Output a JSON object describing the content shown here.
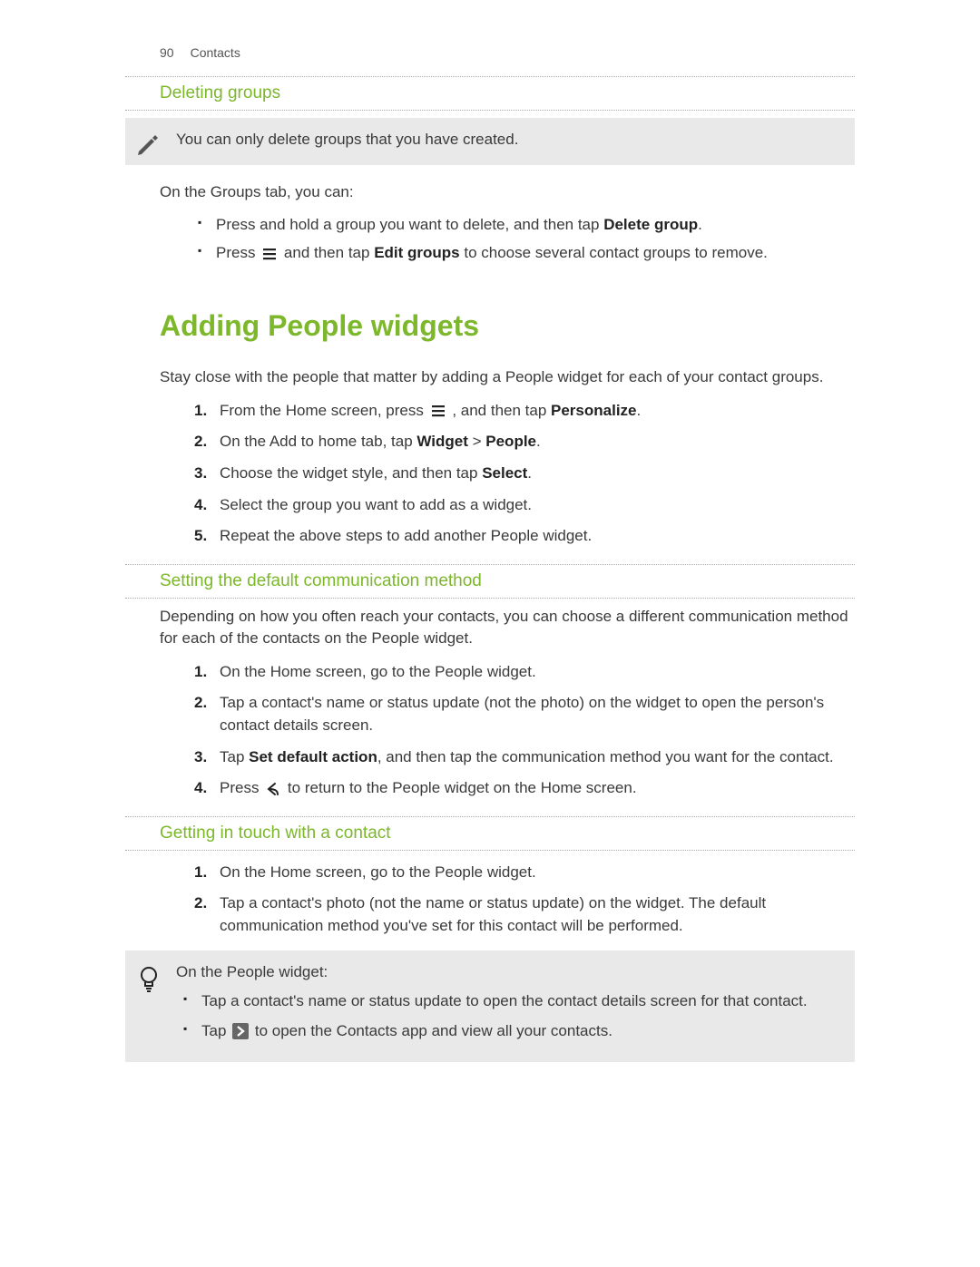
{
  "header": {
    "page": "90",
    "chapter": "Contacts"
  },
  "sec1": {
    "heading": "Deleting groups",
    "note": "You can only delete groups that you have created.",
    "intro": "On the Groups tab, you can:",
    "bullets": {
      "b1_a": "Press and hold a group you want to delete, and then tap ",
      "b1_bold": "Delete group",
      "b1_c": ".",
      "b2_a": "Press ",
      "b2_b": " and then tap ",
      "b2_bold": "Edit groups",
      "b2_c": " to choose several contact groups to remove."
    }
  },
  "sec2": {
    "heading": "Adding People widgets",
    "intro": "Stay close with the people that matter by adding a People widget for each of your contact groups.",
    "steps": {
      "s1_a": "From the Home screen, press ",
      "s1_b": ", and then tap ",
      "s1_bold": "Personalize",
      "s1_c": ".",
      "s2_a": "On the Add to home tab, tap ",
      "s2_bold1": "Widget",
      "s2_gt": " > ",
      "s2_bold2": "People",
      "s2_c": ".",
      "s3_a": "Choose the widget style, and then tap ",
      "s3_bold": "Select",
      "s3_c": ".",
      "s4": "Select the group you want to add as a widget.",
      "s5": "Repeat the above steps to add another People widget."
    }
  },
  "sec3": {
    "heading": "Setting the default communication method",
    "intro": "Depending on how you often reach your contacts, you can choose a different communication method for each of the contacts on the People widget.",
    "steps": {
      "s1": "On the Home screen, go to the People widget.",
      "s2": "Tap a contact's name or status update (not the photo) on the widget to open the person's contact details screen.",
      "s3_a": "Tap ",
      "s3_bold": "Set default action",
      "s3_b": ", and then tap the communication method you want for the contact.",
      "s4_a": "Press ",
      "s4_b": " to return to the People widget on the Home screen."
    }
  },
  "sec4": {
    "heading": "Getting in touch with a contact",
    "steps": {
      "s1": "On the Home screen, go to the People widget.",
      "s2": "Tap a contact's photo (not the name or status update) on the widget. The default communication method you've set for this contact will be performed."
    },
    "tip_intro": "On the People widget:",
    "tip_bullets": {
      "t1": "Tap a contact's name or status update to open the contact details screen for that contact.",
      "t2_a": "Tap ",
      "t2_b": " to open the Contacts app and view all your contacts."
    }
  },
  "nums": {
    "n1": "1.",
    "n2": "2.",
    "n3": "3.",
    "n4": "4.",
    "n5": "5."
  }
}
